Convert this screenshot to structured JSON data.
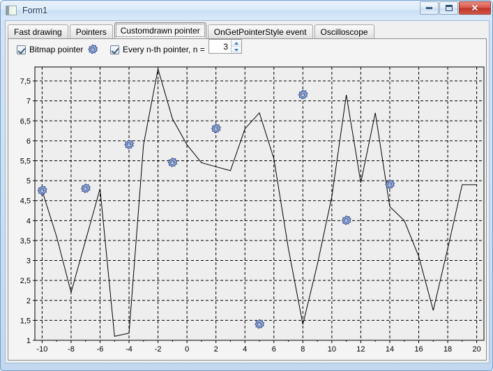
{
  "window": {
    "title": "Form1",
    "icon": "form-icon",
    "buttons": [
      {
        "name": "minimize-button",
        "glyph": "minimize"
      },
      {
        "name": "maximize-button",
        "glyph": "maximize"
      },
      {
        "name": "close-button",
        "glyph": "✕"
      }
    ]
  },
  "tabs": [
    {
      "label": "Fast drawing",
      "selected": false
    },
    {
      "label": "Pointers",
      "selected": false
    },
    {
      "label": "Customdrawn pointer",
      "selected": true
    },
    {
      "label": "OnGetPointerStyle event",
      "selected": false
    },
    {
      "label": "Oscilloscope",
      "selected": false
    }
  ],
  "options": {
    "bitmap_pointer": {
      "label": "Bitmap pointer",
      "checked": true,
      "icon": "star-pointer-icon"
    },
    "every_nth": {
      "label": "Every n-th pointer, n =",
      "checked": true,
      "value": "3"
    }
  },
  "colors": {
    "plot_background": "#eeeeee",
    "grid": "#000000",
    "line": "#000000",
    "marker_fill": "#8fa8d8",
    "marker_stroke": "#37508c",
    "accent": "#4a7ebb"
  },
  "chart_data": {
    "type": "line",
    "title": "",
    "xlabel": "",
    "ylabel": "",
    "xlim": [
      -10.5,
      20.5
    ],
    "ylim": [
      1.0,
      7.85
    ],
    "xticks": [
      -10,
      -8,
      -6,
      -4,
      -2,
      0,
      2,
      4,
      6,
      8,
      10,
      12,
      14,
      16,
      18,
      20
    ],
    "xtick_labels": [
      "-10",
      "-8",
      "-6",
      "-4",
      "-2",
      "0",
      "2",
      "4",
      "6",
      "8",
      "10",
      "12",
      "14",
      "16",
      "18",
      "20"
    ],
    "yticks": [
      1,
      1.5,
      2,
      2.5,
      3,
      3.5,
      4,
      4.5,
      5,
      5.5,
      6,
      6.5,
      7,
      7.5
    ],
    "ytick_labels": [
      "1",
      "1,5",
      "2",
      "2,5",
      "3",
      "3,5",
      "4",
      "4,5",
      "5",
      "5,5",
      "6",
      "6,5",
      "7",
      "7,5"
    ],
    "grid": true,
    "grid_style": "dashed",
    "legend": "none",
    "marker_every": 3,
    "x": [
      -10,
      -9,
      -8,
      -7,
      -6,
      -5,
      -4,
      -3,
      -2,
      -1,
      0,
      1,
      2,
      3,
      4,
      5,
      6,
      7,
      8,
      9,
      10,
      11,
      12,
      13,
      14,
      15,
      16,
      17,
      18,
      19,
      20
    ],
    "y": [
      4.75,
      3.6,
      2.2,
      3.5,
      4.8,
      1.1,
      1.18,
      5.9,
      7.8,
      6.55,
      5.9,
      5.45,
      5.35,
      5.25,
      6.3,
      6.7,
      5.55,
      3.3,
      1.4,
      2.9,
      4.6,
      7.15,
      4.95,
      6.7,
      4.35,
      4.0,
      3.1,
      1.75,
      3.3,
      4.9,
      4.9
    ],
    "markers": [
      {
        "x": -10,
        "y": 4.75
      },
      {
        "x": -7,
        "y": 4.8
      },
      {
        "x": -4,
        "y": 5.9
      },
      {
        "x": -1,
        "y": 5.45
      },
      {
        "x": 2,
        "y": 6.3
      },
      {
        "x": 5,
        "y": 1.4
      },
      {
        "x": 8,
        "y": 7.15
      },
      {
        "x": 11,
        "y": 4.0
      },
      {
        "x": 14,
        "y": 4.9
      }
    ]
  }
}
